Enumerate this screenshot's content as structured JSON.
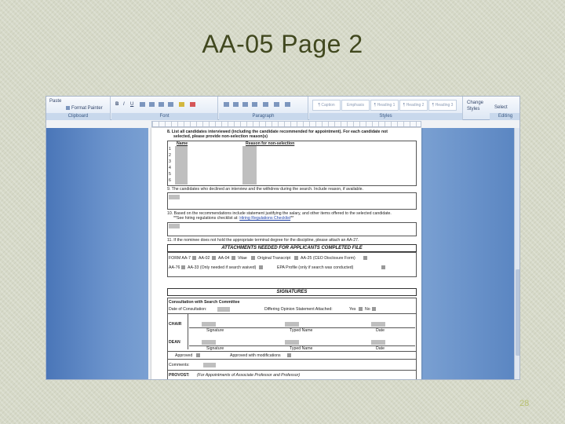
{
  "slide": {
    "title": "AA-05 Page 2",
    "page_number": "28"
  },
  "ribbon": {
    "paste": "Paste",
    "format_painter": "Format Painter",
    "clipboard_label": "Clipboard",
    "font_label": "Font",
    "paragraph_label": "Paragraph",
    "styles_label": "Styles",
    "editing_label": "Editing",
    "styles": [
      "¶ Caption",
      "Emphasis",
      "¶ Heading 1",
      "¶ Heading 2",
      "¶ Heading 3"
    ],
    "change_styles": "Change Styles",
    "select": "Select"
  },
  "document": {
    "item8_a": "8.   List all candidates interviewed (including the candidate recommended for appointment).  For each candidate not",
    "item8_b": "selected, please provide non-selection reason(s)",
    "col_name": "Name",
    "col_reason": "Reason for non-selection",
    "row_numbers": [
      "1",
      "2",
      "3",
      "4",
      "5",
      "6"
    ],
    "item9": "9.   The candidates who declined an interview and the withdrew during the search.  Include reason, if available.",
    "item10_a": "10.  Based on the recommendations include statement justifying the salary, and other items offered to the selected candidate.",
    "item10_b": "**See hiring regulations checklist at:",
    "item10_link": "Hiring Regulations Checklist",
    "item10_c": "**",
    "item11": "11.  If the nominee does not hold the appropriate terminal degree for the discipline, please attach an AA-27.",
    "attachments_banner": "ATTACHMENTS NEEDED FOR APPLICANTS COMPLETED FILE",
    "attach_row1": [
      "FORM AA-7",
      "AA-02",
      "AA-04",
      "Vitae",
      "Original Transcript",
      "AA-25 (CEO Disclosure Form)"
    ],
    "attach_row2": [
      "AA-76",
      "AA-33 (Only needed if search waived)",
      "EPA Profile (only if search was conducted)"
    ],
    "signatures_banner": "SIGNATURES",
    "consult_heading": "Consultation with Search Committee",
    "date_consult": "Date of Consultation:",
    "differing": "Differing Opinion Statement Attached:",
    "yes": "Yes",
    "no": "No",
    "chair": "CHAIR",
    "signature": "Signature",
    "typed_name": "Typed Name",
    "date": "Date",
    "dean": "DEAN",
    "approved": "Approved",
    "approved_mod": "Approved with modifications",
    "comments": "Comments:",
    "provost": "PROVOST:",
    "provost_note": "(For Appointments of Associate Professor and Professor)"
  }
}
